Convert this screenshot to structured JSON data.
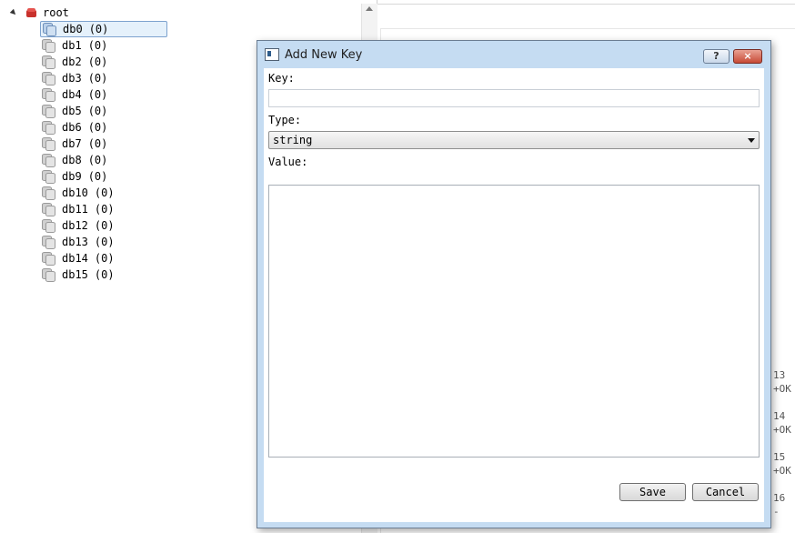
{
  "tree": {
    "root_label": "root",
    "selected_index": 0,
    "databases": [
      {
        "name": "db0",
        "count": "(0)"
      },
      {
        "name": "db1",
        "count": "(0)"
      },
      {
        "name": "db2",
        "count": "(0)"
      },
      {
        "name": "db3",
        "count": "(0)"
      },
      {
        "name": "db4",
        "count": "(0)"
      },
      {
        "name": "db5",
        "count": "(0)"
      },
      {
        "name": "db6",
        "count": "(0)"
      },
      {
        "name": "db7",
        "count": "(0)"
      },
      {
        "name": "db8",
        "count": "(0)"
      },
      {
        "name": "db9",
        "count": "(0)"
      },
      {
        "name": "db10",
        "count": "(0)"
      },
      {
        "name": "db11",
        "count": "(0)"
      },
      {
        "name": "db12",
        "count": "(0)"
      },
      {
        "name": "db13",
        "count": "(0)"
      },
      {
        "name": "db14",
        "count": "(0)"
      },
      {
        "name": "db15",
        "count": "(0)"
      }
    ]
  },
  "console": {
    "lines": [
      "13",
      "+OK",
      "",
      "14",
      "+OK",
      "",
      "15",
      "+OK",
      "",
      "16",
      "-ERR"
    ]
  },
  "dialog": {
    "title": "Add New Key",
    "help_label": "?",
    "close_label": "×",
    "key_label": "Key:",
    "key_value": "",
    "type_label": "Type:",
    "type_value": "string",
    "value_label": "Value:",
    "value_text": "",
    "save_label": "Save",
    "cancel_label": "Cancel"
  },
  "colors": {
    "dialog_frame": "#c5dcf2",
    "selection_bg": "#e5f1fb",
    "selection_border": "#7da2ce",
    "root_icon": "#c8312c",
    "close_button": "#c74a36"
  }
}
